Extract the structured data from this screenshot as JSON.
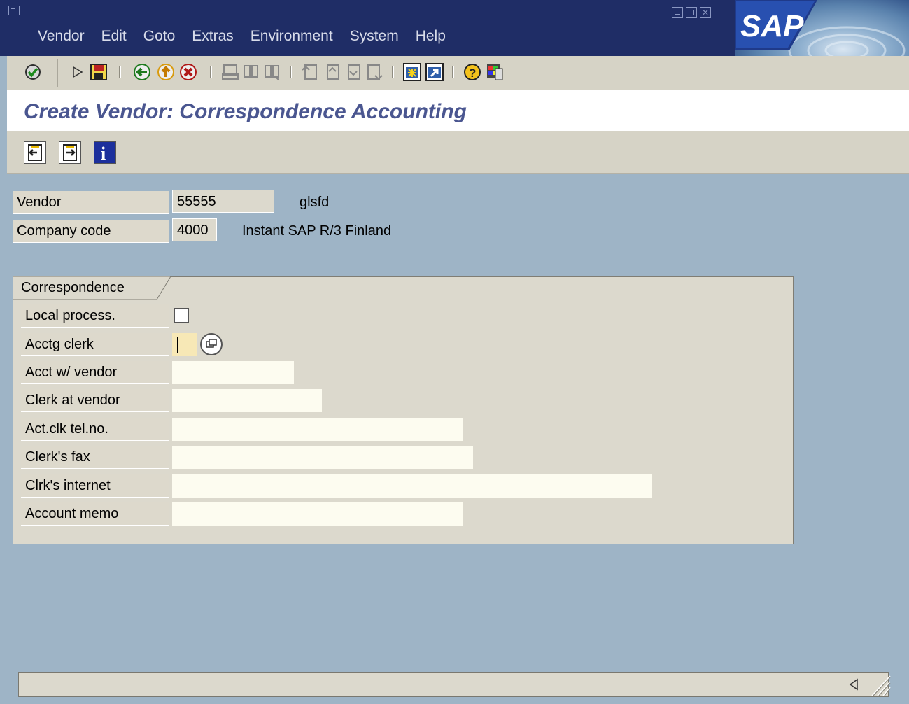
{
  "menu": {
    "items": [
      {
        "label": "Vendor"
      },
      {
        "label": "Edit"
      },
      {
        "label": "Goto"
      },
      {
        "label": "Extras"
      },
      {
        "label": "Environment"
      },
      {
        "label": "System"
      },
      {
        "label": "Help"
      }
    ],
    "logo_text": "SAP"
  },
  "toolbar": {
    "icons": [
      "enter-icon",
      "command-field-icon",
      "save-icon",
      "back-icon",
      "exit-icon",
      "cancel-icon",
      "print-icon",
      "find-icon",
      "find-next-icon",
      "first-page-icon",
      "previous-page-icon",
      "next-page-icon",
      "last-page-icon",
      "create-session-icon",
      "create-shortcut-icon",
      "help-icon",
      "layout-menu-icon"
    ]
  },
  "title": "Create Vendor: Correspondence Accounting",
  "app_toolbar": {
    "icons": [
      "previous-screen-icon",
      "next-screen-icon",
      "info-icon"
    ]
  },
  "header_fields": {
    "vendor": {
      "label": "Vendor",
      "value": "55555",
      "description": "glsfd"
    },
    "company_code": {
      "label": "Company code",
      "value": "4000",
      "description": "Instant SAP R/3 Finland"
    }
  },
  "group": {
    "title": "Correspondence",
    "fields": {
      "local_process": {
        "label": "Local process.",
        "checked": false
      },
      "acctg_clerk": {
        "label": "Acctg clerk",
        "value": ""
      },
      "acct_w_vendor": {
        "label": "Acct w/ vendor",
        "value": ""
      },
      "clerk_at_vendor": {
        "label": "Clerk at vendor",
        "value": ""
      },
      "act_clk_tel": {
        "label": "Act.clk tel.no.",
        "value": ""
      },
      "clerks_fax": {
        "label": "Clerk's fax",
        "value": ""
      },
      "clrks_internet": {
        "label": "Clrk's internet",
        "value": ""
      },
      "account_memo": {
        "label": "Account memo",
        "value": ""
      }
    }
  },
  "status_bar": {
    "text": ""
  },
  "colors": {
    "menubar_bg": "#1f2d66",
    "title_color": "#4a5690",
    "body_bg": "#9eb4c6",
    "panel_bg": "#d6d3c6",
    "input_bg": "#fdfcf0"
  }
}
